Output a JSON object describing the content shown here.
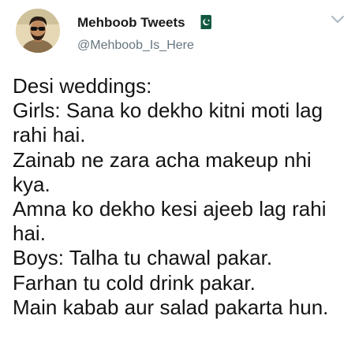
{
  "author": {
    "display_name": "Mehboob Tweets",
    "username": "@Mehboob_Is_Here",
    "avatar_icon": "avatar-portrait",
    "badge_icon": "pakistan-flag-icon"
  },
  "menu_icon": "chevron-down-icon",
  "tweet": {
    "lines": [
      "Desi weddings:",
      "Girls: Sana ko dekho kitni moti lag",
      "rahi hai.",
      "Zainab ne zara acha makeup nhi",
      "kya.",
      "Amna ko dekho kesi ajeeb lag rahi",
      "hai.",
      "Boys: Talha tu chawal pakar.",
      "Farhan tu cold drink pakar.",
      "Main kabab aur salad pakarta hun."
    ]
  },
  "colors": {
    "text": "#141414",
    "secondary": "#66757f",
    "flag_green": "#115740",
    "chevron": "#aab8c2"
  }
}
